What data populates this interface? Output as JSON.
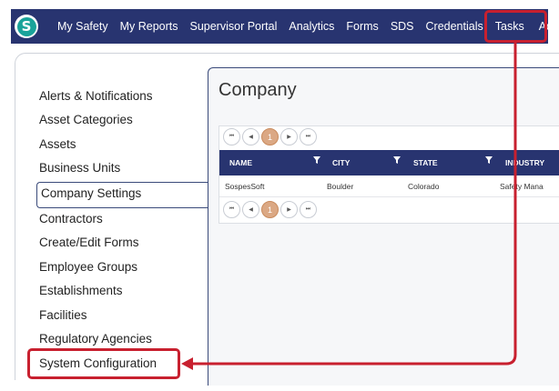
{
  "navbar": {
    "logo_letter": "S",
    "items": [
      "My Safety",
      "My Reports",
      "Supervisor Portal",
      "Analytics",
      "Forms",
      "SDS",
      "Credentials",
      "Tasks",
      "Admin"
    ]
  },
  "sidebar": {
    "items": [
      "Alerts & Notifications",
      "Asset Categories",
      "Assets",
      "Business Units",
      "Company Settings",
      "Contractors",
      "Create/Edit Forms",
      "Employee Groups",
      "Establishments",
      "Facilities",
      "Regulatory Agencies",
      "System Configuration"
    ],
    "selected": "Company Settings"
  },
  "content": {
    "title": "Company",
    "pager": {
      "first": "⏮",
      "prev": "◀",
      "page": "1",
      "next": "▶",
      "last": "⏭"
    },
    "columns": [
      "NAME",
      "CITY",
      "STATE",
      "INDUSTRY"
    ],
    "rows": [
      {
        "name": "SospesSoft",
        "city": "Boulder",
        "state": "Colorado",
        "industry": "Safety Mana"
      }
    ]
  },
  "colors": {
    "navbar": "#283470",
    "annotation": "#c8202f",
    "logo": "#1aa39a"
  }
}
